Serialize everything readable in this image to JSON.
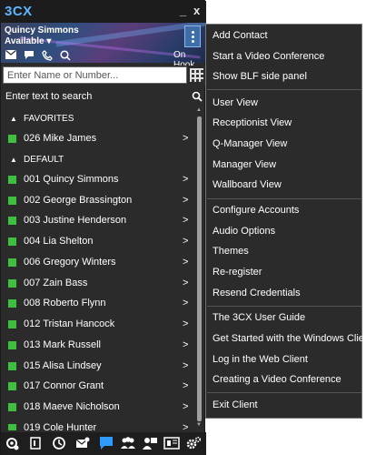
{
  "app": {
    "logo": "3CX",
    "minimize_glyph": "_",
    "close_glyph": "x"
  },
  "user": {
    "name": "Quincy Simmons",
    "status": "Available",
    "hook_status": "On Hook"
  },
  "dial": {
    "placeholder": "Enter Name or Number..."
  },
  "search": {
    "label": "Enter text to search"
  },
  "groups": [
    {
      "label": "FAVORITES",
      "contacts": [
        {
          "name": "026 Mike James",
          "presence": "available"
        }
      ]
    },
    {
      "label": "DEFAULT",
      "contacts": [
        {
          "name": "001 Quincy Simmons",
          "presence": "available"
        },
        {
          "name": "002 George Brassington",
          "presence": "available"
        },
        {
          "name": "003 Justine Henderson",
          "presence": "available"
        },
        {
          "name": "004 Lia Shelton",
          "presence": "available"
        },
        {
          "name": "006 Gregory Winters",
          "presence": "available"
        },
        {
          "name": "007 Zain Bass",
          "presence": "available"
        },
        {
          "name": "008 Roberto Flynn",
          "presence": "available"
        },
        {
          "name": "012 Tristan Hancock",
          "presence": "available"
        },
        {
          "name": "013 Mark Russell",
          "presence": "available"
        },
        {
          "name": "015 Alisa Lindsey",
          "presence": "available"
        },
        {
          "name": "017 Connor Grant",
          "presence": "available"
        },
        {
          "name": "018 Maeve Nicholson",
          "presence": "available"
        },
        {
          "name": "019 Cole Hunter",
          "presence": "available"
        }
      ]
    }
  ],
  "chevron": ">",
  "menu": {
    "items": [
      "Add Contact",
      "Start a Video Conference",
      "Show BLF side panel",
      "User View",
      "Receptionist View",
      "Q-Manager View",
      "Manager View",
      "Wallboard View",
      "Configure Accounts",
      "Audio Options",
      "Themes",
      "Re-register",
      "Resend Credentials",
      "The 3CX User Guide",
      "Get Started with the Windows Client",
      "Log in the Web Client",
      "Creating a Video Conference",
      "Exit Client"
    ]
  },
  "colors": {
    "presence_available": "#3fbf3f",
    "accent": "#2f9bff",
    "window_bg": "#2b2b2b"
  },
  "icons": {
    "header": [
      "envelope-icon",
      "chat-icon",
      "phone-icon",
      "search-icon"
    ],
    "bottom": [
      "settings-icon",
      "dialer-icon",
      "history-icon",
      "voicemail-icon",
      "chat-icon",
      "group-icon",
      "conference-icon",
      "switchboard-icon",
      "gear-icon"
    ]
  }
}
